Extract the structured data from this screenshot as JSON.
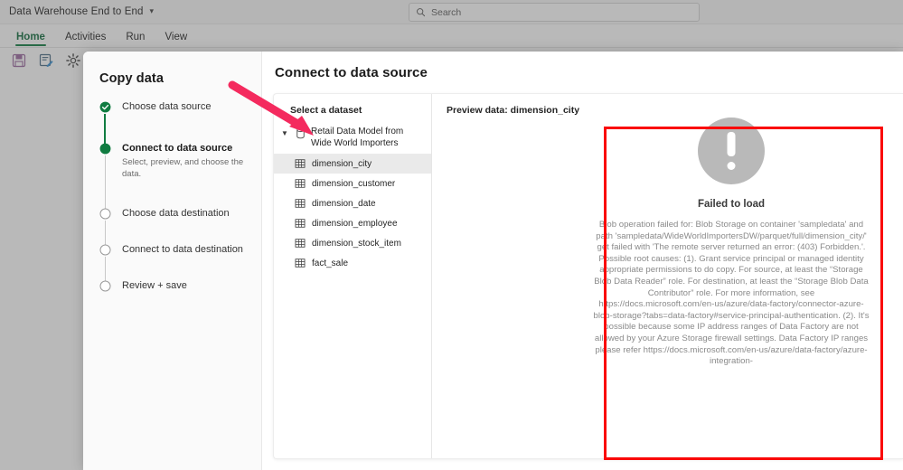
{
  "window": {
    "title": "Data Warehouse End to End",
    "title_chevron_icon": "chevron-down-icon"
  },
  "search": {
    "placeholder": "Search",
    "icon": "search-icon"
  },
  "ribbon": {
    "tabs": [
      {
        "label": "Home",
        "active": true
      },
      {
        "label": "Activities",
        "active": false
      },
      {
        "label": "Run",
        "active": false
      },
      {
        "label": "View",
        "active": false
      }
    ]
  },
  "toolbar": {
    "items": [
      {
        "icon": "save-icon",
        "label": "Save"
      },
      {
        "icon": "edit-note-icon",
        "label": "Edit"
      },
      {
        "icon": "gear-icon",
        "label": "Settings"
      }
    ]
  },
  "wizard": {
    "title": "Copy data",
    "steps": [
      {
        "label": "Choose data source",
        "state": "done",
        "sub": ""
      },
      {
        "label": "Connect to data source",
        "state": "current",
        "sub": "Select, preview, and choose the data."
      },
      {
        "label": "Choose data destination",
        "state": "pending",
        "sub": ""
      },
      {
        "label": "Connect to data destination",
        "state": "pending",
        "sub": ""
      },
      {
        "label": "Review + save",
        "state": "pending",
        "sub": ""
      }
    ]
  },
  "content": {
    "title": "Connect to data source",
    "dataset_pane": {
      "heading": "Select a dataset",
      "tree_root": {
        "label": "Retail Data Model from Wide World Importers",
        "icon": "database-icon",
        "chevron_icon": "chevron-down-icon",
        "expanded": true
      },
      "tables": [
        {
          "label": "dimension_city",
          "icon": "table-icon",
          "selected": true
        },
        {
          "label": "dimension_customer",
          "icon": "table-icon",
          "selected": false
        },
        {
          "label": "dimension_date",
          "icon": "table-icon",
          "selected": false
        },
        {
          "label": "dimension_employee",
          "icon": "table-icon",
          "selected": false
        },
        {
          "label": "dimension_stock_item",
          "icon": "table-icon",
          "selected": false
        },
        {
          "label": "fact_sale",
          "icon": "table-icon",
          "selected": false
        }
      ]
    },
    "preview_pane": {
      "heading": "Preview data: dimension_city",
      "error": {
        "icon": "exclamation-circle-icon",
        "title": "Failed to load",
        "message": "Blob operation failed for: Blob Storage on container 'sampledata' and path 'sampledata/WideWorldImportersDW/parquet/full/dimension_city/' get failed with 'The remote server returned an error: (403) Forbidden.'. Possible root causes: (1). Grant service principal or managed identity appropriate permissions to do copy. For source, at least the “Storage Blob Data Reader” role. For destination, at least the “Storage Blob Data Contributor” role. For more information, see https://docs.microsoft.com/en-us/azure/data-factory/connector-azure-blob-storage?tabs=data-factory#service-principal-authentication. (2). It's possible because some IP address ranges of Data Factory are not allowed by your Azure Storage firewall settings. Data Factory IP ranges please refer https://docs.microsoft.com/en-us/azure/data-factory/azure-integration-"
      }
    }
  },
  "annotations": {
    "highlight_box_color": "#fa0a0a",
    "arrow_color": "#f42a5e",
    "arrow_target": "Select a dataset / dataset tree",
    "highlight_target": "Preview data error message"
  },
  "colors": {
    "accent_green": "#107c41",
    "selection_gray": "#eaeaea",
    "error_icon_gray": "#b9b9b9"
  }
}
